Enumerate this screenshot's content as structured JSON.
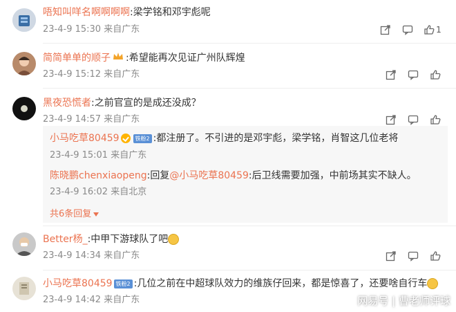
{
  "comments": [
    {
      "user": "唔知叫咩名啊啊啊啊",
      "text": ":梁学铭和邓宇彪呢",
      "meta": "23-4-9 15:30 来自广东",
      "likes": "1"
    },
    {
      "user": "简简单单的顺子",
      "text": ":希望能再次见证广州队辉煌",
      "meta": "23-4-9 15:12 来自广东"
    },
    {
      "user": "黑夜恐慌者",
      "text": ":之前官宣的是成还没成？",
      "meta": "23-4-9 14:57 来自广东",
      "replies": [
        {
          "user": "小马吃草80459",
          "badge": "铁粉2",
          "text": ":都注册了。不引进的是邓宇彪，梁学铭，肖智这几位老将",
          "meta": "23-4-9 15:01 来自广东"
        },
        {
          "user": "陈晓鹏chenxiaopeng",
          "reply_prefix": ":回复",
          "reply_to": "@小马吃草80459",
          "text": ":后卫线需要加强，中前场其实不缺人。",
          "meta": "23-4-9 16:02 来自北京"
        }
      ],
      "more_replies": "共6条回复"
    },
    {
      "user": "Better杨_",
      "text": ":中甲下游球队了吧",
      "meta": "23-4-9 14:34 来自广东"
    },
    {
      "user": "小马吃草80459",
      "badge": "铁粉2",
      "text": ":几位之前在中超球队效力的维族仔回来，都是惊喜了，还要啥自行车",
      "meta": "23-4-9 14:42 来自广东"
    }
  ],
  "watermark": "网易号 | 曹老师评球",
  "icons": [
    "share-icon",
    "comment-icon",
    "like-icon"
  ],
  "colors": {
    "username": "#eb7350",
    "meta": "#8a8a8a",
    "reply_bg": "#f7f7f7"
  }
}
